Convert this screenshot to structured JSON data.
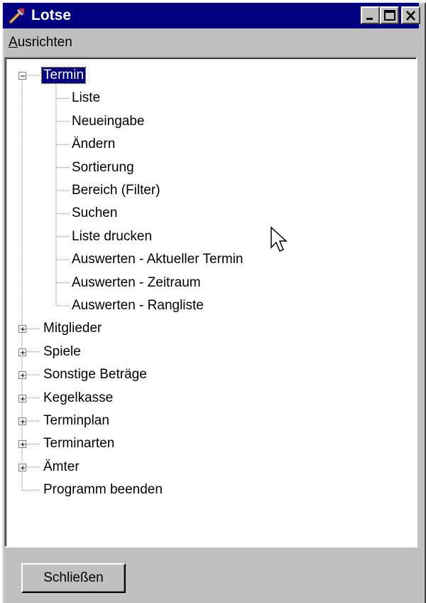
{
  "window": {
    "title": "Lotse",
    "icon": "tools-icon",
    "controls": [
      "minimize-icon",
      "maximize-icon",
      "close-icon"
    ]
  },
  "menu": {
    "ausrichten_first": "A",
    "ausrichten_rest": "usrichten"
  },
  "tree": {
    "root": {
      "label": "Termin",
      "expanded": true,
      "children": [
        "Liste",
        "Neueingabe",
        "Ändern",
        "Sortierung",
        "Bereich (Filter)",
        "Suchen",
        "Liste drucken",
        "Auswerten - Aktueller Termin",
        "Auswerten - Zeitraum",
        "Auswerten - Rangliste"
      ]
    },
    "collapsed": [
      "Mitglieder",
      "Spiele",
      "Sonstige Beträge",
      "Kegelkasse",
      "Terminplan",
      "Terminarten",
      "Ämter"
    ],
    "leaf": "Programm beenden"
  },
  "footer": {
    "close_label": "Schließen"
  },
  "colors": {
    "titlebar": "#000080",
    "face": "#c0c0c0",
    "selection": "#000080"
  }
}
